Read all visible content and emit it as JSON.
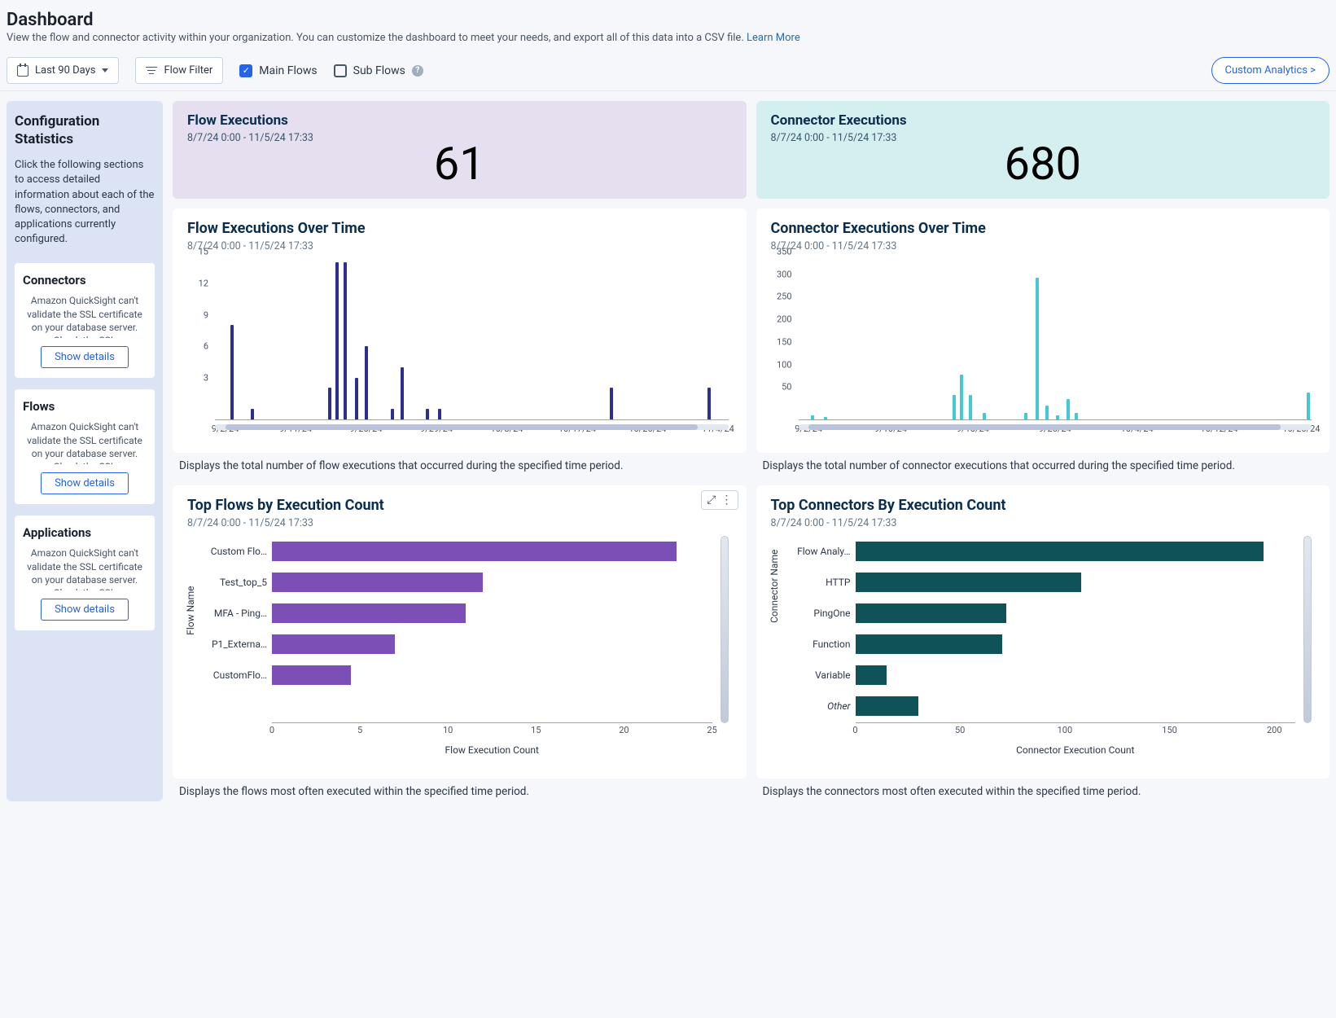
{
  "header": {
    "title": "Dashboard",
    "subtitle": "View the flow and connector activity within your organization. You can customize the dashboard to meet your needs, and export all of this data into a CSV file.",
    "learn_more": "Learn More"
  },
  "toolbar": {
    "date_range": "Last 90 Days",
    "flow_filter": "Flow Filter",
    "main_flows": "Main Flows",
    "sub_flows": "Sub Flows",
    "custom_analytics": "Custom Analytics >"
  },
  "sidebar": {
    "title": "Configuration Statistics",
    "intro": "Click the following sections to access detailed information about each of the flows, connectors, and applications currently configured.",
    "cards": [
      {
        "title": "Connectors",
        "msg": "Amazon QuickSight can't validate the SSL certificate on your database server. Check the SSL",
        "btn": "Show details"
      },
      {
        "title": "Flows",
        "msg": "Amazon QuickSight can't validate the SSL certificate on your database server. Check the SSL",
        "btn": "Show details"
      },
      {
        "title": "Applications",
        "msg": "Amazon QuickSight can't validate the SSL certificate on your database server. Check the SSL",
        "btn": "Show details"
      }
    ]
  },
  "kpi": {
    "flow": {
      "title": "Flow Executions",
      "range": "8/7/24 0:00 - 11/5/24 17:33",
      "value": "61"
    },
    "conn": {
      "title": "Connector Executions",
      "range": "8/7/24 0:00 - 11/5/24 17:33",
      "value": "680"
    }
  },
  "flow_over_time": {
    "title": "Flow Executions Over Time",
    "range": "8/7/24 0:00 - 11/5/24 17:33",
    "desc": "Displays the total number of flow executions that occurred during the specified time period."
  },
  "conn_over_time": {
    "title": "Connector Executions Over Time",
    "range": "8/7/24 0:00 - 11/5/24 17:33",
    "desc": "Displays the total number of connector executions that occurred during the specified time period."
  },
  "top_flows": {
    "title": "Top Flows by Execution Count",
    "range": "8/7/24 0:00 - 11/5/24 17:33",
    "desc": "Displays the flows most often executed within the specified time period.",
    "xlabel": "Flow Execution Count",
    "ylabel": "Flow Name"
  },
  "top_conn": {
    "title": "Top Connectors By Execution Count",
    "range": "8/7/24 0:00 - 11/5/24 17:33",
    "desc": "Displays the connectors most often executed within the specified time period.",
    "xlabel": "Connector Execution Count",
    "ylabel": "Connector Name"
  },
  "chart_data": [
    {
      "id": "flow_over_time",
      "type": "bar",
      "yticks": [
        3,
        6,
        9,
        12,
        15
      ],
      "ylim": [
        0,
        15
      ],
      "xticks": [
        "9/2/24",
        "9/11/24",
        "9/20/24",
        "9/29/24",
        "10/8/24",
        "10/17/24",
        "10/26/24",
        "11/4/24"
      ],
      "series": [
        {
          "name": "Flow",
          "color": "#2d2f8f",
          "points": [
            {
              "x": 0.03,
              "y": 9
            },
            {
              "x": 0.07,
              "y": 1
            },
            {
              "x": 0.22,
              "y": 3
            },
            {
              "x": 0.235,
              "y": 15
            },
            {
              "x": 0.25,
              "y": 15
            },
            {
              "x": 0.273,
              "y": 4
            },
            {
              "x": 0.292,
              "y": 7
            },
            {
              "x": 0.343,
              "y": 1
            },
            {
              "x": 0.362,
              "y": 5
            },
            {
              "x": 0.41,
              "y": 1
            },
            {
              "x": 0.435,
              "y": 1
            },
            {
              "x": 0.77,
              "y": 3
            },
            {
              "x": 0.96,
              "y": 3
            }
          ]
        }
      ]
    },
    {
      "id": "conn_over_time",
      "type": "bar",
      "yticks": [
        50,
        100,
        150,
        200,
        250,
        300,
        350
      ],
      "ylim": [
        0,
        350
      ],
      "xticks": [
        "9/2/24",
        "9/10/24",
        "9/18/24",
        "9/26/24",
        "10/4/24",
        "10/12/24",
        "10/20/24"
      ],
      "series": [
        {
          "name": "Connector",
          "color": "#45c8d6",
          "points": [
            {
              "x": 0.025,
              "y": 10
            },
            {
              "x": 0.05,
              "y": 5
            },
            {
              "x": 0.3,
              "y": 55
            },
            {
              "x": 0.315,
              "y": 100
            },
            {
              "x": 0.333,
              "y": 55
            },
            {
              "x": 0.36,
              "y": 15
            },
            {
              "x": 0.44,
              "y": 15
            },
            {
              "x": 0.463,
              "y": 315
            },
            {
              "x": 0.482,
              "y": 30
            },
            {
              "x": 0.502,
              "y": 10
            },
            {
              "x": 0.522,
              "y": 45
            },
            {
              "x": 0.539,
              "y": 15
            },
            {
              "x": 0.99,
              "y": 60
            }
          ]
        }
      ]
    },
    {
      "id": "top_flows",
      "type": "bar_h",
      "xticks": [
        0,
        5,
        10,
        15,
        20,
        25
      ],
      "xlim": [
        0,
        25
      ],
      "categories": [
        "Custom Flo…",
        "Test_top_5",
        "MFA - Ping…",
        "P1_Externa…",
        "CustomFlo…"
      ],
      "values": [
        23,
        12,
        11,
        7,
        4.5
      ],
      "color": "#7b4fb5"
    },
    {
      "id": "top_conn",
      "type": "bar_h",
      "xticks": [
        0,
        50,
        100,
        150,
        200
      ],
      "xlim": [
        0,
        210
      ],
      "categories": [
        "Flow Analy…",
        "HTTP",
        "PingOne",
        "Function",
        "Variable",
        "Other"
      ],
      "italic_last": true,
      "values": [
        195,
        108,
        72,
        70,
        15,
        30
      ],
      "color": "#0f5257"
    }
  ]
}
